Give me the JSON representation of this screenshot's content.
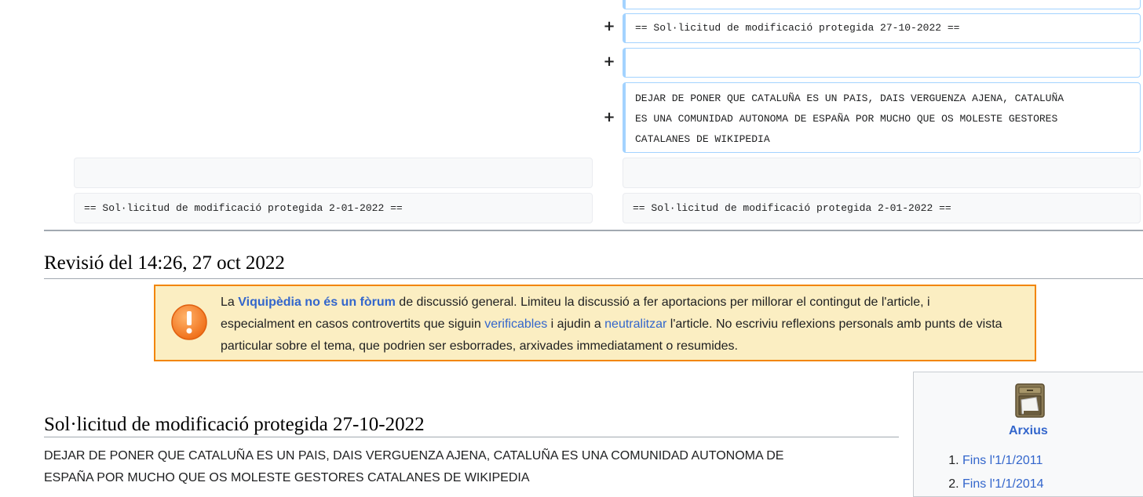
{
  "diff": {
    "marker": "+",
    "added": {
      "heading": "== Sol·licitud de modificació protegida 27-10-2022 ==",
      "blank": "",
      "body_lines": [
        "DEJAR DE PONER QUE CATALUÑA ES UN PAIS, DAIS VERGUENZA AJENA, CATALUÑA",
        "ES UNA COMUNIDAD AUTONOMA DE ESPAÑA POR MUCHO QUE OS MOLESTE GESTORES",
        "CATALANES DE WIKIPEDIA"
      ]
    },
    "context_left": "== Sol·licitud de modificació protegida 2-01-2022 ==",
    "context_right": "== Sol·licitud de modificació protegida 2-01-2022 =="
  },
  "revision_heading": "Revisió del 14:26, 27 oct 2022",
  "notice": {
    "icon": "exclamation-icon",
    "t1": "La ",
    "link1": "Viquipèdia no és un fòrum",
    "t2": " de discussió general. Limiteu la discussió a fer aportacions per millorar el contingut de l'article, i especialment en casos controvertits que siguin ",
    "link2": "verificables",
    "t3": " i ajudin a ",
    "link3": "neutralitzar",
    "t4": " l'article. No escriviu reflexions personals amb punts de vista particular sobre el tema, que podrien ser esborrades, arxivades immediatament o resumides."
  },
  "archive": {
    "icon": "filing-cabinet-icon",
    "title": "Arxius",
    "items": [
      "Fins l'1/1/2011",
      "Fins l'1/1/2014"
    ]
  },
  "section": {
    "heading": "Sol·licitud de modificació protegida 27-10-2022",
    "body_line1": "DEJAR DE PONER QUE CATALUÑA ES UN PAIS, DAIS VERGUENZA AJENA, CATALUÑA ES UNA COMUNIDAD AUTONOMA DE",
    "body_line2": "ESPAÑA POR MUCHO QUE OS MOLESTE GESTORES CATALANES DE WIKIPEDIA"
  },
  "colors": {
    "added_border": "#a3d3ff",
    "notice_bg": "#fbeec2",
    "notice_border": "#f28500",
    "link": "#3366cc"
  }
}
